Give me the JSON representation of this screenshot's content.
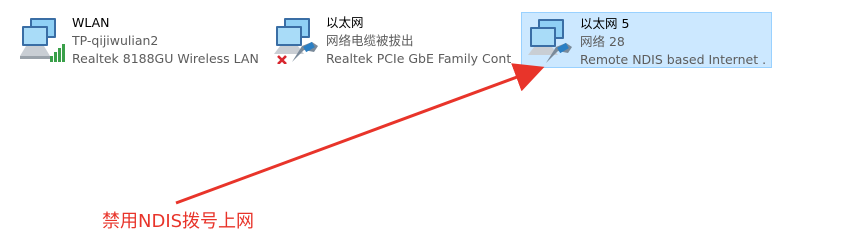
{
  "adapters": [
    {
      "name": "WLAN",
      "status": "TP-qijiwulian2",
      "device": "Realtek 8188GU Wireless LAN ...",
      "icon": "wifi-adapter-icon",
      "selected": false
    },
    {
      "name": "以太网",
      "status": "网络电缆被拔出",
      "device": "Realtek PCIe GbE Family Contr...",
      "icon": "ethernet-disconnected-icon",
      "selected": false
    },
    {
      "name": "以太网 5",
      "status": "网络 28",
      "device": "Remote NDIS based Internet ...",
      "icon": "ethernet-connected-icon",
      "selected": true
    }
  ],
  "annotation": {
    "text": "禁用NDIS拨号上网",
    "color": "#e8342a"
  },
  "colors": {
    "selection_bg": "#cce8ff",
    "selection_border": "#99d1ff",
    "accent_red": "#e8342a"
  }
}
